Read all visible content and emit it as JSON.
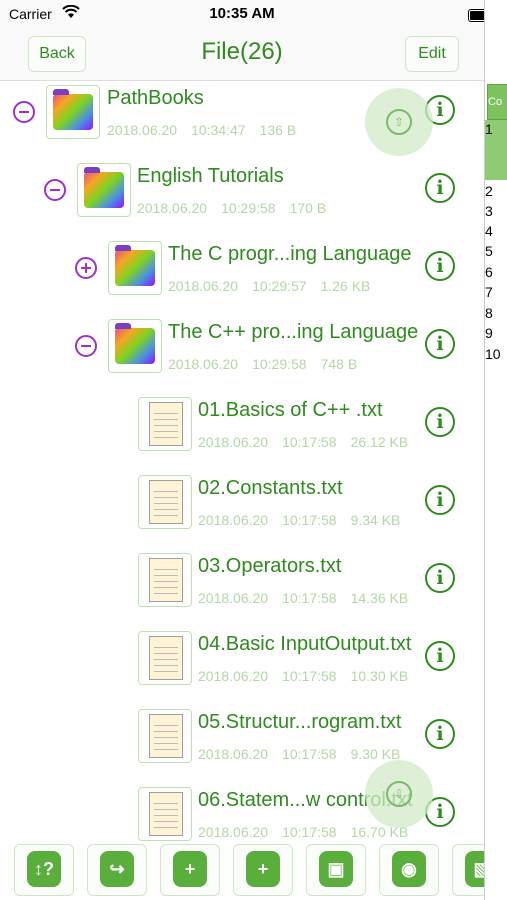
{
  "status_bar": {
    "carrier": "Carrier",
    "time": "10:35 AM"
  },
  "nav": {
    "back_label": "Back",
    "title": "File(26)",
    "edit_label": "Edit"
  },
  "files": [
    {
      "name": "PathBooks",
      "date": "2018.06.20",
      "time": "10:34:47",
      "size": "136 B",
      "type": "folder",
      "toggle": "collapse"
    },
    {
      "name": "English Tutorials",
      "date": "2018.06.20",
      "time": "10:29:58",
      "size": "170 B",
      "type": "folder",
      "toggle": "collapse"
    },
    {
      "name": "The C progr...ing Language",
      "date": "2018.06.20",
      "time": "10:29:57",
      "size": "1.26 KB",
      "type": "folder",
      "toggle": "expand"
    },
    {
      "name": "The C++ pro...ing Language",
      "date": "2018.06.20",
      "time": "10:29:58",
      "size": "748 B",
      "type": "folder",
      "toggle": "collapse"
    },
    {
      "name": "01.Basics of C++ .txt",
      "date": "2018.06.20",
      "time": "10:17:58",
      "size": "26.12 KB",
      "type": "text"
    },
    {
      "name": "02.Constants.txt",
      "date": "2018.06.20",
      "time": "10:17:58",
      "size": "9.34 KB",
      "type": "text"
    },
    {
      "name": "03.Operators.txt",
      "date": "2018.06.20",
      "time": "10:17:58",
      "size": "14.36 KB",
      "type": "text"
    },
    {
      "name": "04.Basic InputOutput.txt",
      "date": "2018.06.20",
      "time": "10:17:58",
      "size": "10.30 KB",
      "type": "text"
    },
    {
      "name": "05.Structur...rogram.txt",
      "date": "2018.06.20",
      "time": "10:17:58",
      "size": "9.30 KB",
      "type": "text"
    },
    {
      "name": "06.Statem...w control.txt",
      "date": "2018.06.20",
      "time": "10:17:58",
      "size": "16.70 KB",
      "type": "text"
    }
  ],
  "info_glyph": "i",
  "side_panel": {
    "tab_label": "Co",
    "numbers": [
      "1",
      "2",
      "3",
      "4",
      "5",
      "6",
      "7",
      "8",
      "9",
      "10"
    ]
  },
  "toolbar": [
    {
      "icon": "sort-icon",
      "glyph": "↕?"
    },
    {
      "icon": "open-folder-icon",
      "glyph": "↪"
    },
    {
      "icon": "new-folder-icon",
      "glyph": "+"
    },
    {
      "icon": "new-file-icon",
      "glyph": "+"
    },
    {
      "icon": "add-image-icon",
      "glyph": "▣"
    },
    {
      "icon": "camera-icon",
      "glyph": "◉"
    },
    {
      "icon": "photo-icon",
      "glyph": "▧"
    }
  ],
  "colors": {
    "accent": "#2e8b1e",
    "toggle": "#a030c8",
    "meta": "#b5d6a8"
  }
}
